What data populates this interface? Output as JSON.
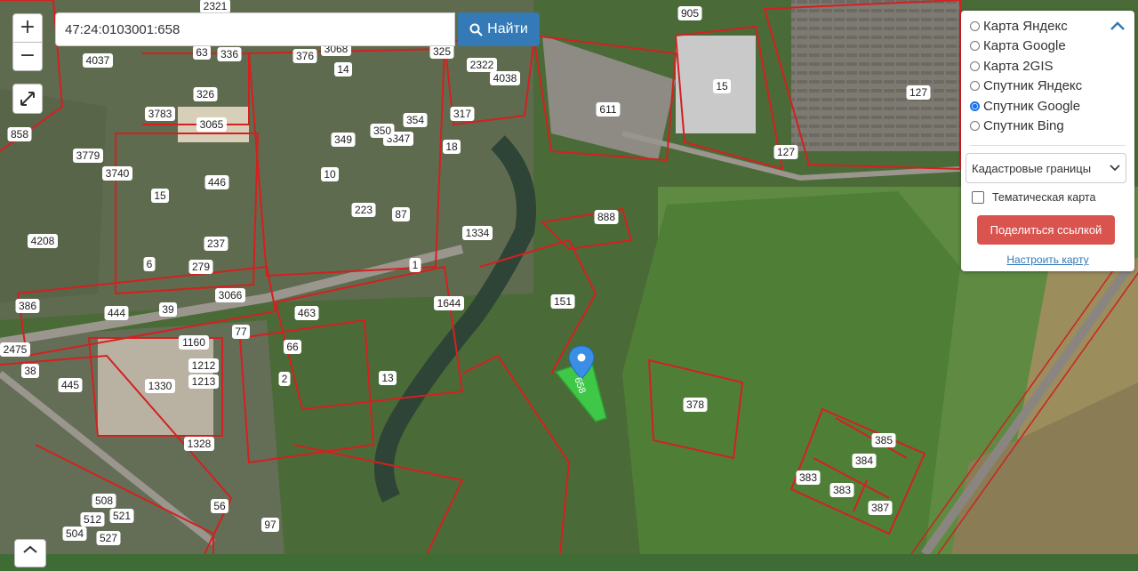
{
  "search": {
    "value": "47:24:0103001:658",
    "button_label": "Найти"
  },
  "zoom": {
    "in_label": "+",
    "out_label": "−"
  },
  "layers_panel": {
    "options": [
      {
        "label": "Карта Яндекс",
        "selected": false
      },
      {
        "label": "Карта Google",
        "selected": false
      },
      {
        "label": "Карта 2GIS",
        "selected": false
      },
      {
        "label": "Спутник Яндекс",
        "selected": false
      },
      {
        "label": "Спутник Google",
        "selected": true
      },
      {
        "label": "Спутник Bing",
        "selected": false
      }
    ],
    "overlay_select": "Кадастровые границы",
    "thematic_label": "Тематическая карта",
    "thematic_checked": false,
    "share_label": "Поделиться ссылкой",
    "configure_label": "Настроить карту"
  },
  "map": {
    "selected_parcel_label": "658",
    "parcel_labels": [
      "2321",
      "905",
      "325",
      "2322",
      "4038",
      "63",
      "336",
      "3068",
      "376",
      "14",
      "4037",
      "326",
      "3783",
      "3065",
      "354",
      "3347",
      "350",
      "349",
      "317",
      "15",
      "611",
      "127",
      "858",
      "3779",
      "3740",
      "446",
      "10",
      "18",
      "15",
      "127",
      "4208",
      "237",
      "223",
      "87",
      "888",
      "1334",
      "6",
      "279",
      "3066",
      "1",
      "1644",
      "151",
      "386",
      "444",
      "39",
      "463",
      "2475",
      "38",
      "77",
      "1160",
      "66",
      "1212",
      "445",
      "1330",
      "1213",
      "2",
      "13",
      "378",
      "1328",
      "385",
      "384",
      "383",
      "383",
      "387",
      "508",
      "512",
      "521",
      "527",
      "504",
      "56",
      "97"
    ],
    "colors": {
      "parcel_border": "#d42020",
      "label_bg": "#ffffff",
      "selected_fill": "#3ed84a",
      "marker": "#3a8ee6"
    }
  }
}
